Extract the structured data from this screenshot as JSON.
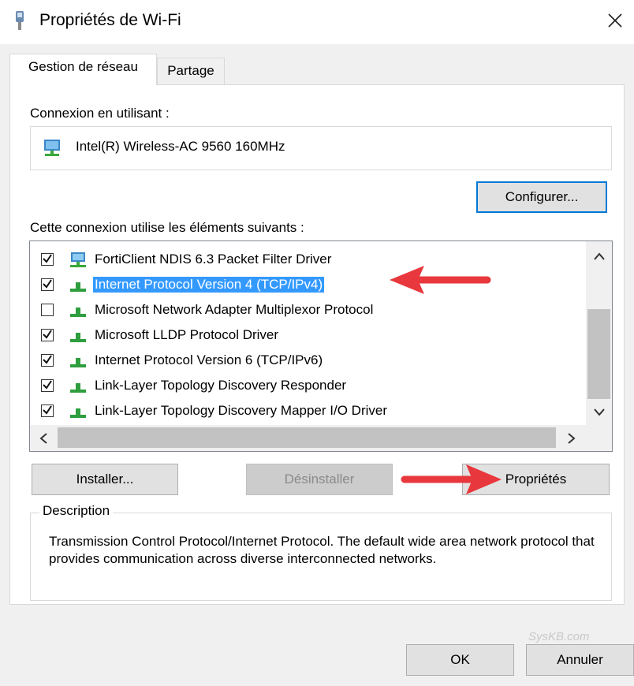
{
  "window": {
    "title": "Propriétés de Wi-Fi",
    "close_glyph": "×",
    "icon": "network-adapter-icon"
  },
  "tabs": [
    {
      "label": "Gestion de réseau",
      "active": true
    },
    {
      "label": "Partage",
      "active": false
    }
  ],
  "connection": {
    "label": "Connexion en utilisant :",
    "adapter_name": "Intel(R) Wireless-AC 9560 160MHz",
    "adapter_icon": "network-adapter-icon",
    "configure_label": "Configurer..."
  },
  "components": {
    "label": "Cette connexion utilise les éléments suivants :",
    "items": [
      {
        "label": "FortiClient NDIS 6.3 Packet Filter Driver",
        "checked": true,
        "icon": "monitor-network-icon",
        "selected": false
      },
      {
        "label": "Internet Protocol Version 4 (TCP/IPv4)",
        "checked": true,
        "icon": "protocol-icon",
        "selected": true
      },
      {
        "label": "Microsoft Network Adapter Multiplexor Protocol",
        "checked": false,
        "icon": "protocol-icon",
        "selected": false
      },
      {
        "label": "Microsoft LLDP Protocol Driver",
        "checked": true,
        "icon": "protocol-icon",
        "selected": false
      },
      {
        "label": "Internet Protocol Version 6 (TCP/IPv6)",
        "checked": true,
        "icon": "protocol-icon",
        "selected": false
      },
      {
        "label": "Link-Layer Topology Discovery Responder",
        "checked": true,
        "icon": "protocol-icon",
        "selected": false
      },
      {
        "label": "Link-Layer Topology Discovery Mapper I/O Driver",
        "checked": true,
        "icon": "protocol-icon",
        "selected": false
      }
    ]
  },
  "buttons": {
    "install": "Installer...",
    "uninstall": "Désinstaller",
    "properties": "Propriétés",
    "ok": "OK",
    "cancel": "Annuler"
  },
  "description": {
    "legend": "Description",
    "text": "Transmission Control Protocol/Internet Protocol. The default wide area network protocol that provides communication across diverse interconnected networks."
  },
  "watermark": "SysKB.com",
  "colors": {
    "selection": "#3399ff",
    "annotation_arrow": "#e8383d",
    "focus_border": "#0078d7"
  }
}
